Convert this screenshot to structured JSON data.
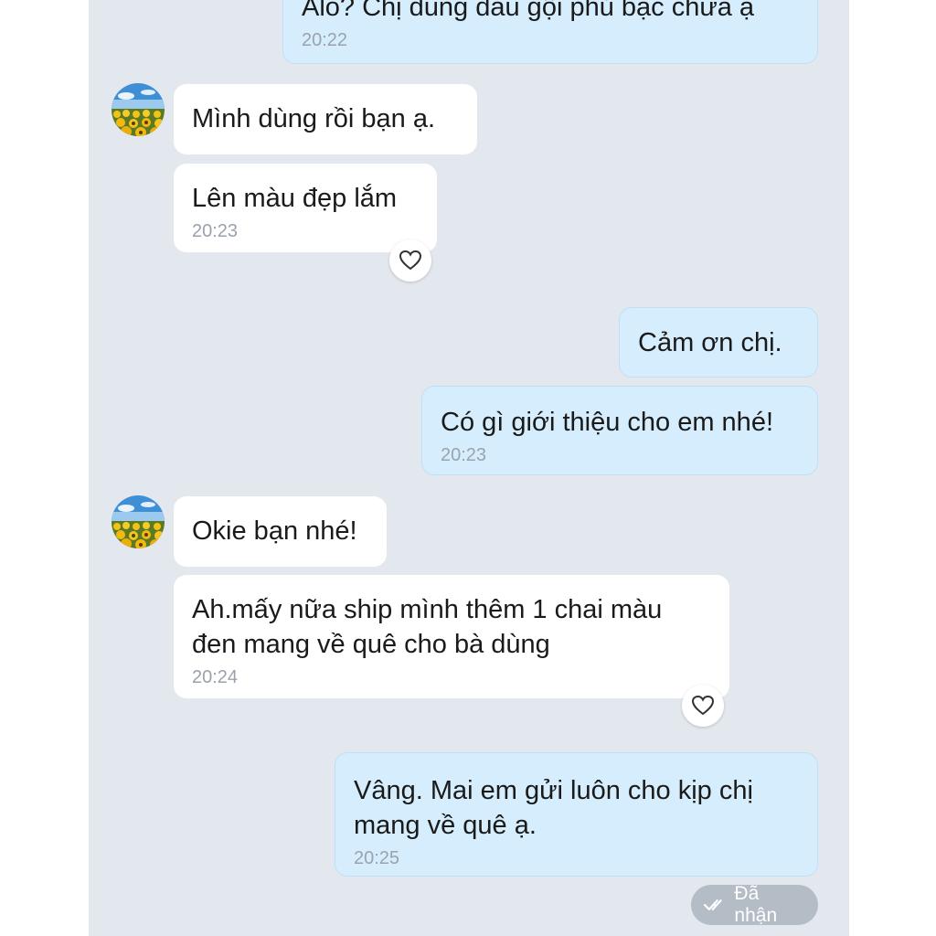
{
  "messages": [
    {
      "id": "m1",
      "dir": "out",
      "text": "Alo? Chị dùng  dầu gội phủ bạc chưa ạ",
      "time": "20:22"
    },
    {
      "id": "m2",
      "dir": "in",
      "text": "Mình dùng rồi bạn ạ."
    },
    {
      "id": "m3",
      "dir": "in",
      "text": "Lên màu đẹp lắm",
      "time": "20:23"
    },
    {
      "id": "m4",
      "dir": "out",
      "text": "Cảm ơn chị."
    },
    {
      "id": "m5",
      "dir": "out",
      "text": "Có gì giới thiệu cho em nhé!",
      "time": "20:23"
    },
    {
      "id": "m6",
      "dir": "in",
      "text": "Okie bạn nhé!"
    },
    {
      "id": "m7",
      "dir": "in",
      "text_line1": "Ah.mấy nữa ship mình thêm 1 chai màu",
      "text_line2": "đen mang về quê cho bà dùng",
      "time": "20:24"
    },
    {
      "id": "m8",
      "dir": "out",
      "text_line1": "Vâng. Mai em gửi luôn cho kịp chị",
      "text_line2": "mang về quê ạ.",
      "time": "20:25"
    }
  ],
  "status": {
    "label": "Đã nhận",
    "icon": "double-check-icon"
  },
  "icons": {
    "react": "heart-icon",
    "avatar": "sunflower-field-avatar"
  },
  "colors": {
    "background": "#e3e8ee",
    "incoming": "#ffffff",
    "outgoing": "#d5edfc",
    "time": "#9aa3ad",
    "status": "#b4bcc6"
  }
}
